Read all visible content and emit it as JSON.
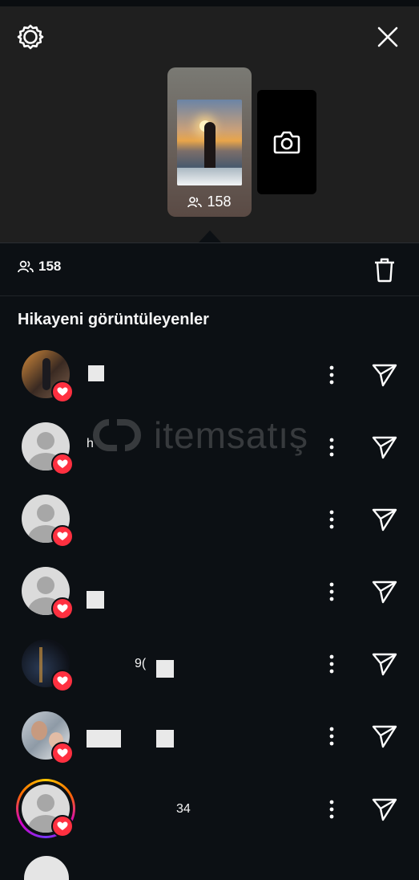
{
  "header": {
    "settings_icon": "gear-icon",
    "close_icon": "close-icon"
  },
  "story": {
    "viewer_count": "158",
    "camera_icon": "camera-icon"
  },
  "summary": {
    "viewer_count": "158",
    "delete_icon": "trash-icon"
  },
  "section_title": "Hikayeni görüntüleyenler",
  "watermark": "itemsatış",
  "viewers": [
    {
      "name": "",
      "avatar": "photo",
      "liked": true
    },
    {
      "name": "h",
      "avatar": "default",
      "liked": true
    },
    {
      "name": "",
      "avatar": "default",
      "liked": true
    },
    {
      "name": "",
      "avatar": "default",
      "liked": true
    },
    {
      "name": "9(",
      "avatar": "photo",
      "liked": true
    },
    {
      "name": "",
      "avatar": "photo",
      "liked": true
    },
    {
      "name": "34",
      "avatar": "default",
      "liked": true,
      "story_ring": true
    }
  ],
  "colors": {
    "background": "#0c1014",
    "header_bg": "#1f1f1f",
    "like": "#ff3040"
  }
}
